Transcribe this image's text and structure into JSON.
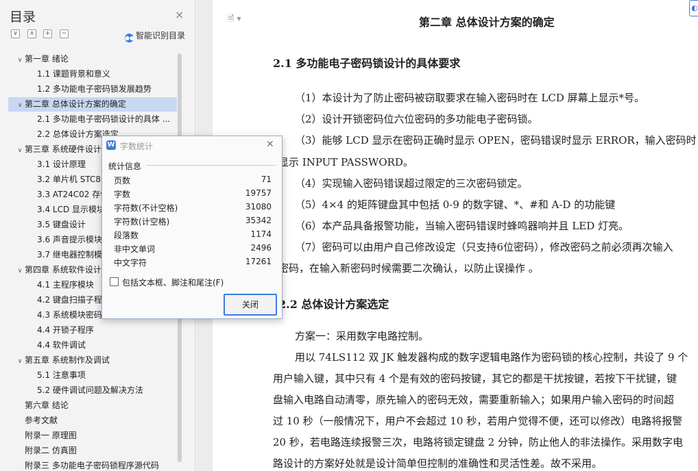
{
  "toc": {
    "title": "目录",
    "close_icon": "×",
    "smart_label": "智能识别目录",
    "items": [
      {
        "label": "第一章  绪论",
        "arrow": "∨"
      },
      {
        "label": "1.1  课题背景和意义",
        "arrow": ""
      },
      {
        "label": "1.2  多功能电子密码锁发展趋势",
        "arrow": ""
      },
      {
        "label": "第二章  总体设计方案的确定",
        "arrow": "∨",
        "selected": true
      },
      {
        "label": "2.1  多功能电子密码锁设计的具体 ...",
        "arrow": ""
      },
      {
        "label": "2.2  总体设计方案选定",
        "arrow": ""
      },
      {
        "label": "第三章  系统硬件设计",
        "arrow": "∨"
      },
      {
        "label": "3.1   设计原理",
        "arrow": ""
      },
      {
        "label": "3.2   单片机 STC89C52",
        "arrow": ""
      },
      {
        "label": "3.3   AT24C02 存储",
        "arrow": ""
      },
      {
        "label": "3.4   LCD 显示模块",
        "arrow": ""
      },
      {
        "label": "3.5   键盘设计",
        "arrow": ""
      },
      {
        "label": "3.6   声音提示模块",
        "arrow": ""
      },
      {
        "label": "3.7  继电器控制模块",
        "arrow": ""
      },
      {
        "label": "第四章  系统软件设计",
        "arrow": "∨"
      },
      {
        "label": "4.1 主程序模块",
        "arrow": ""
      },
      {
        "label": "4.2  键盘扫描子程序",
        "arrow": ""
      },
      {
        "label": "4.3  系统模块密码",
        "arrow": ""
      },
      {
        "label": "4.4 开锁子程序",
        "arrow": ""
      },
      {
        "label": "4.4 软件调试",
        "arrow": ""
      },
      {
        "label": "第五章  系统制作及调试",
        "arrow": "∨"
      },
      {
        "label": "5.1  注意事项",
        "arrow": ""
      },
      {
        "label": "5.2  硬件调试问题及解决方法",
        "arrow": ""
      },
      {
        "label": "第六章  结论",
        "arrow": ""
      },
      {
        "label": "参考文献",
        "arrow": ""
      },
      {
        "label": "附录一  原理图",
        "arrow": ""
      },
      {
        "label": "附录二  仿真图",
        "arrow": ""
      },
      {
        "label": "附录三  多功能电子密码锁程序源代码",
        "arrow": ""
      }
    ]
  },
  "document": {
    "lines": [
      {
        "text": "第二章  总体设计方案的确定",
        "cls": "h-chapter"
      },
      {
        "text": "2.1  多功能电子密码锁设计的具体要求",
        "cls": "h-sec"
      },
      {
        "text": "（1）本设计为了防止密码被窃取要求在输入密码时在 LCD 屏幕上显示*号。",
        "cls": ""
      },
      {
        "text": "（2）设计开锁密码位六位密码的多功能电子密码锁。",
        "cls": ""
      },
      {
        "text": "（3）能够 LCD 显示在密码正确时显示 OPEN，密码错误时显示  ERROR，输入密码时",
        "cls": ""
      },
      {
        "text": "显示 INPUT    PASSWORD。",
        "cls": ""
      },
      {
        "text": "（4）实现输入密码错误超过限定的三次密码锁定。",
        "cls": ""
      },
      {
        "text": "（5）4×4 的矩阵键盘其中包括 0-9 的数字键、*、#和 A-D 的功能键",
        "cls": ""
      },
      {
        "text": "（6）本产品具备报警功能，当输入密码错误时蜂鸣器响并且 LED 灯亮。",
        "cls": ""
      },
      {
        "text": "（7）密码可以由用户自己修改设定（只支持6位密码），修改密码之前必须再次输入",
        "cls": ""
      },
      {
        "text": "密码，在输入新密码时候需要二次确认，以防止误操作  。",
        "cls": ""
      },
      {
        "text": "2.2  总体设计方案选定",
        "cls": "h-sec"
      },
      {
        "text": "方案一：采用数字电路控制。",
        "cls": ""
      },
      {
        "text": "用以 74LS112 双 JK 触发器构成的数字逻辑电路作为密码锁的核心控制，共设了 9 个",
        "cls": ""
      },
      {
        "text": "用户输入键，其中只有 4 个是有效的密码按键，其它的都是干扰按键，若按下干扰键，键",
        "cls": ""
      },
      {
        "text": "盘输入电路自动清零，原先输入的密码无效，需要重新输入；如果用户输入密码的时间超",
        "cls": ""
      },
      {
        "text": "过 10 秒（一般情况下，用户不会超过 10 秒，若用户觉得不便，还可以修改）电路将报警",
        "cls": ""
      },
      {
        "text": "20 秒，若电路连续报警三次，电路将锁定键盘 2 分钟，防止他人的非法操作。采用数字电",
        "cls": ""
      },
      {
        "text": "路设计的方案好处就是设计简单但控制的准确性和灵活性差。故不采用。",
        "cls": ""
      }
    ]
  },
  "dialog": {
    "title": "字数统计",
    "section_label": "统计信息",
    "stats": [
      {
        "label": "页数",
        "value": "71"
      },
      {
        "label": "字数",
        "value": "19757"
      },
      {
        "label": "字符数(不计空格)",
        "value": "31080"
      },
      {
        "label": "字符数(计空格)",
        "value": "35342"
      },
      {
        "label": "段落数",
        "value": "1174"
      },
      {
        "label": "非中文单词",
        "value": "2496"
      },
      {
        "label": "中文字符",
        "value": "17261"
      }
    ],
    "checkbox_label": "包括文本框、脚注和尾注(F)",
    "close_button": "关闭"
  },
  "colors": {
    "accent": "#3d7be0",
    "selection": "#c9d8f2"
  }
}
